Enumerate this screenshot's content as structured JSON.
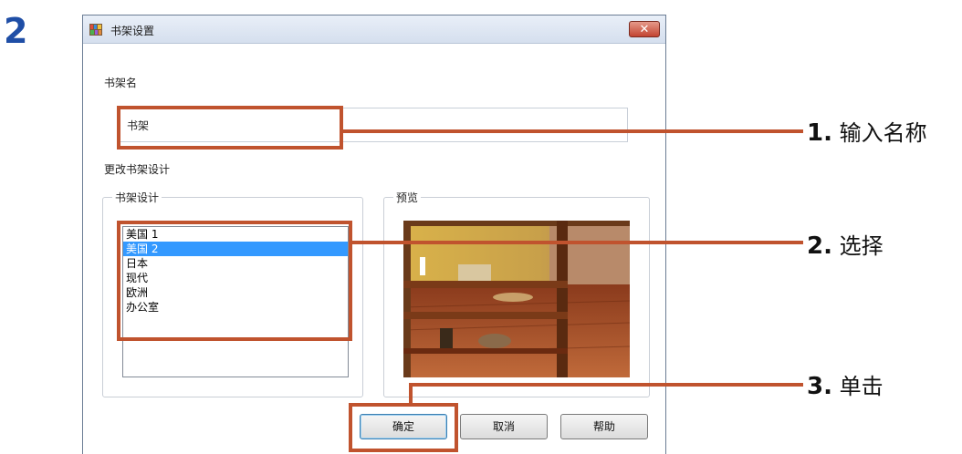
{
  "step_number": "2",
  "dialog": {
    "title": "书架设置",
    "close_label": "✕",
    "name_label": "书架名",
    "name_value": "书架",
    "change_design_label": "更改书架设计",
    "design_group_title": "书架设计",
    "preview_group_title": "预览",
    "design_options": [
      "美国 1",
      "美国 2",
      "日本",
      "现代",
      "欧洲",
      "办公室"
    ],
    "selected_option": "美国 2",
    "buttons": {
      "ok": "确定",
      "cancel": "取消",
      "help": "帮助"
    }
  },
  "callouts": {
    "c1_num": "1.",
    "c1_text": "输入名称",
    "c2_num": "2.",
    "c2_text": "选择",
    "c3_num": "3.",
    "c3_text": "单击"
  },
  "colors": {
    "highlight": "#c0532e",
    "step_number": "#1f4ea6",
    "selection": "#3399ff"
  }
}
